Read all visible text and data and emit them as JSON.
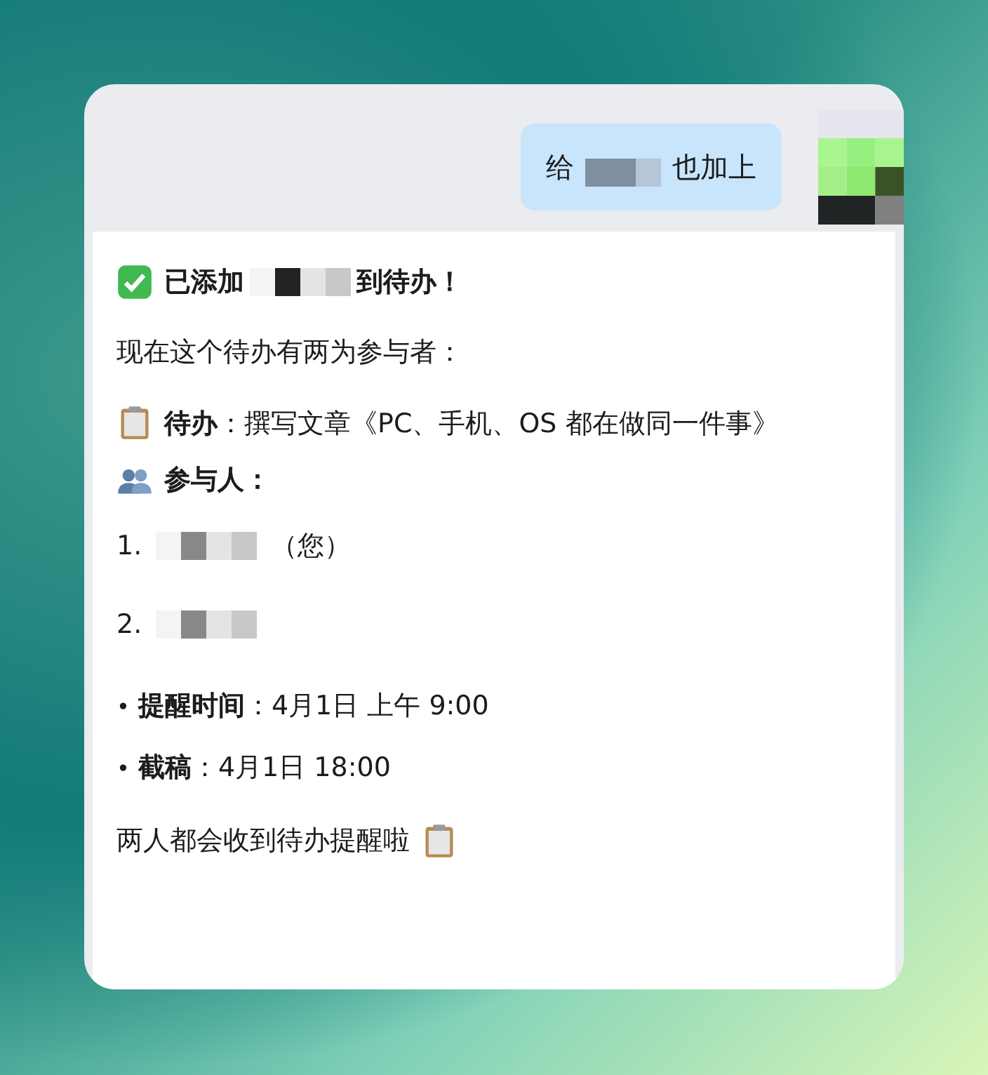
{
  "user_message": {
    "segments": [
      {
        "kind": "text",
        "text": "给"
      },
      {
        "kind": "redacted"
      },
      {
        "kind": "text",
        "text": "也加上"
      }
    ]
  },
  "reply": {
    "confirmation": [
      {
        "kind": "text",
        "text": "已添加"
      },
      {
        "kind": "redacted"
      },
      {
        "kind": "text",
        "text": "到待办！"
      }
    ],
    "intro": "现在这个待办有两为参与者：",
    "task": {
      "label": "待办",
      "text": "：撰写文章《PC、手机、OS 都在做同一件事》"
    },
    "participants_label": "参与人：",
    "participants": [
      {
        "number": "1.",
        "note": "（您）"
      },
      {
        "number": "2."
      }
    ],
    "details": [
      {
        "bullet": "•",
        "label": "提醒时间",
        "value": "：4月1日 上午 9:00"
      },
      {
        "bullet": "•",
        "label": "截稿",
        "value": "：4月1日 18:00"
      }
    ],
    "closing": "两人都会收到待办提醒啦"
  }
}
